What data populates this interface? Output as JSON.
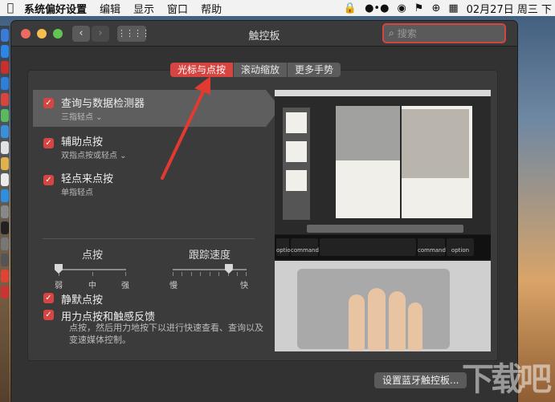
{
  "menubar": {
    "apple": "",
    "app": "系统偏好设置",
    "items": [
      "编辑",
      "显示",
      "窗口",
      "帮助"
    ],
    "datetime": "02月27日 周三 下"
  },
  "window": {
    "title": "触控板",
    "search_placeholder": "搜索",
    "nav_back": "‹",
    "nav_forward": "›",
    "grid": "⋮⋮⋮⋮"
  },
  "tabs": [
    "光标与点按",
    "滚动缩放",
    "更多手势"
  ],
  "features": [
    {
      "label": "查询与数据检测器",
      "sub": "三指轻点 ⌄",
      "checked": true
    },
    {
      "label": "辅助点按",
      "sub": "双指点按或轻点 ⌄",
      "checked": true
    },
    {
      "label": "轻点来点按",
      "sub": "单指轻点",
      "checked": true
    }
  ],
  "click_slider": {
    "title": "点按",
    "labels": [
      "弱",
      "中",
      "强"
    ],
    "value": "弱"
  },
  "tracking_slider": {
    "title": "跟踪速度",
    "labels": [
      "慢",
      "快"
    ],
    "level": 0.76
  },
  "silent_click": {
    "label": "静默点按",
    "checked": true
  },
  "force_click": {
    "label": "用力点按和触感反馈",
    "checked": true,
    "desc": "点按，然后用力地按下以进行快速查看、查询以及变速媒体控制。"
  },
  "preview_keys": {
    "option": "option",
    "command": "command",
    "cmd_symbol": "⌘",
    "alt_symbol": "⌥"
  },
  "bluetooth_button": "设置蓝牙触控板...",
  "watermark": "下载吧",
  "colors": {
    "accent": "#d64541",
    "window_bg": "#323232"
  }
}
